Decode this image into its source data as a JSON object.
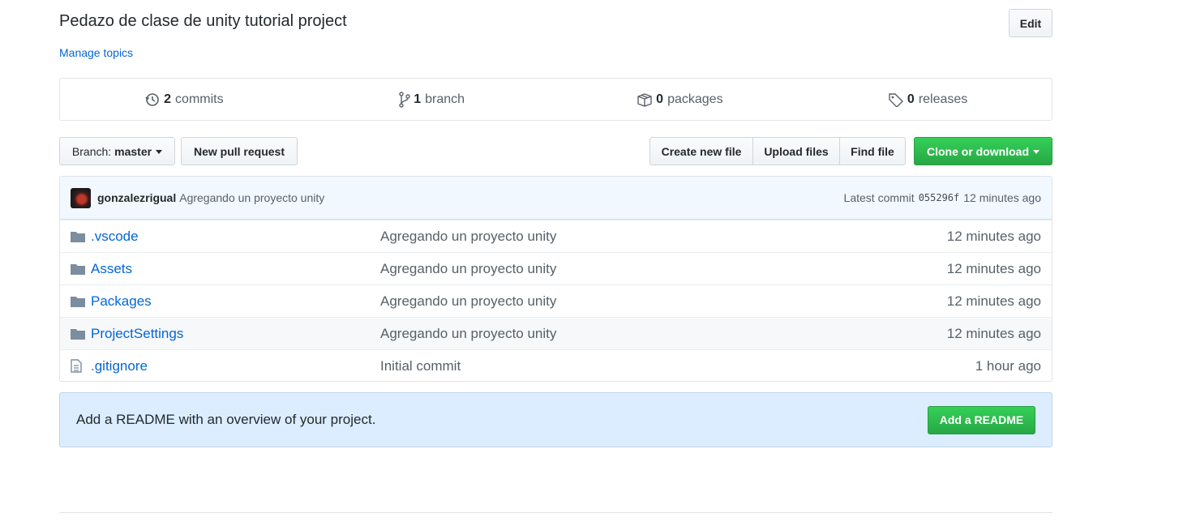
{
  "repo": {
    "description": "Pedazo de clase de unity tutorial project",
    "edit_label": "Edit",
    "manage_topics": "Manage topics"
  },
  "summary": {
    "commits": {
      "count": "2",
      "label": "commits",
      "icon": "history-icon"
    },
    "branches": {
      "count": "1",
      "label": "branch",
      "icon": "git-branch-icon"
    },
    "packages": {
      "count": "0",
      "label": "packages",
      "icon": "package-icon"
    },
    "releases": {
      "count": "0",
      "label": "releases",
      "icon": "tag-icon"
    }
  },
  "toolbar": {
    "branch_prefix": "Branch:",
    "branch_name": "master",
    "new_pull_request": "New pull request",
    "create_new_file": "Create new file",
    "upload_files": "Upload files",
    "find_file": "Find file",
    "clone_or_download": "Clone or download"
  },
  "latest_commit": {
    "author": "gonzalezrigual",
    "message": "Agregando un proyecto unity",
    "label": "Latest commit",
    "sha": "055296f",
    "age": "12 minutes ago"
  },
  "files": [
    {
      "name": ".vscode",
      "type": "folder",
      "message": "Agregando un proyecto unity",
      "age": "12 minutes ago"
    },
    {
      "name": "Assets",
      "type": "folder",
      "message": "Agregando un proyecto unity",
      "age": "12 minutes ago"
    },
    {
      "name": "Packages",
      "type": "folder",
      "message": "Agregando un proyecto unity",
      "age": "12 minutes ago"
    },
    {
      "name": "ProjectSettings",
      "type": "folder",
      "message": "Agregando un proyecto unity",
      "age": "12 minutes ago"
    },
    {
      "name": ".gitignore",
      "type": "file",
      "message": "Initial commit",
      "age": "1 hour ago"
    }
  ],
  "readme_banner": {
    "text": "Add a README with an overview of your project.",
    "button": "Add a README"
  },
  "colors": {
    "link": "#0366d6",
    "primary_green": "#28a745",
    "banner_blue": "#dbedff"
  }
}
